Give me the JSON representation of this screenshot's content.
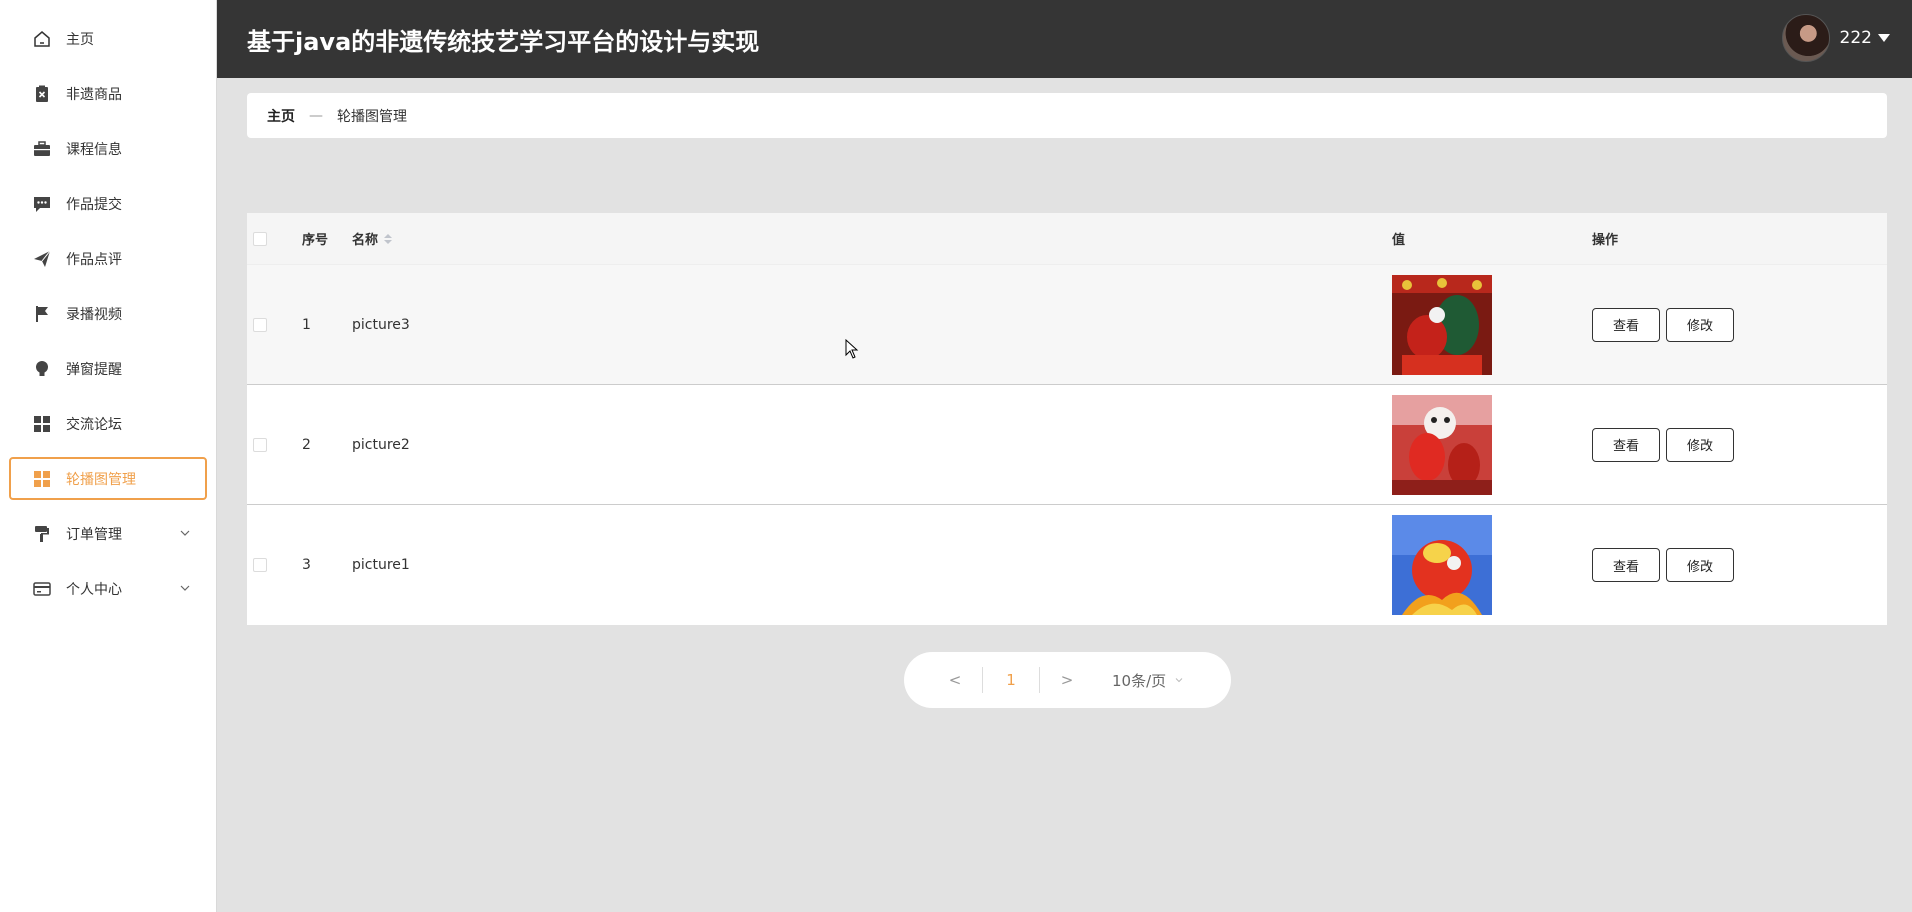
{
  "app_title": "基于java的非遗传统技艺学习平台的设计与实现",
  "user": {
    "name": "222"
  },
  "sidebar": {
    "items": [
      {
        "label": "主页",
        "icon": "home-icon"
      },
      {
        "label": "非遗商品",
        "icon": "clipboard-x-icon"
      },
      {
        "label": "课程信息",
        "icon": "briefcase-icon"
      },
      {
        "label": "作品提交",
        "icon": "chat-bubble-icon"
      },
      {
        "label": "作品点评",
        "icon": "paper-plane-icon"
      },
      {
        "label": "录播视频",
        "icon": "flag-icon"
      },
      {
        "label": "弹窗提醒",
        "icon": "lightbulb-icon"
      },
      {
        "label": "交流论坛",
        "icon": "grid-icon"
      },
      {
        "label": "轮播图管理",
        "icon": "grid-icon",
        "active": true
      },
      {
        "label": "订单管理",
        "icon": "paint-roller-icon",
        "expandable": true
      },
      {
        "label": "个人中心",
        "icon": "credit-card-icon",
        "expandable": true
      }
    ],
    "active_color": "#f0a04b"
  },
  "breadcrumb": {
    "home": "主页",
    "separator": "—",
    "current": "轮播图管理"
  },
  "table": {
    "headers": {
      "index": "序号",
      "name": "名称",
      "value": "值",
      "actions": "操作"
    },
    "rows": [
      {
        "index": "1",
        "name": "picture3",
        "image": "lion-dance-red-green"
      },
      {
        "index": "2",
        "name": "picture2",
        "image": "lion-dance-white-red"
      },
      {
        "index": "3",
        "name": "picture1",
        "image": "lion-dance-red-sky"
      }
    ],
    "view_label": "查看",
    "edit_label": "修改"
  },
  "pagination": {
    "prev": "<",
    "page": "1",
    "next": ">",
    "page_size": "10条/页"
  }
}
